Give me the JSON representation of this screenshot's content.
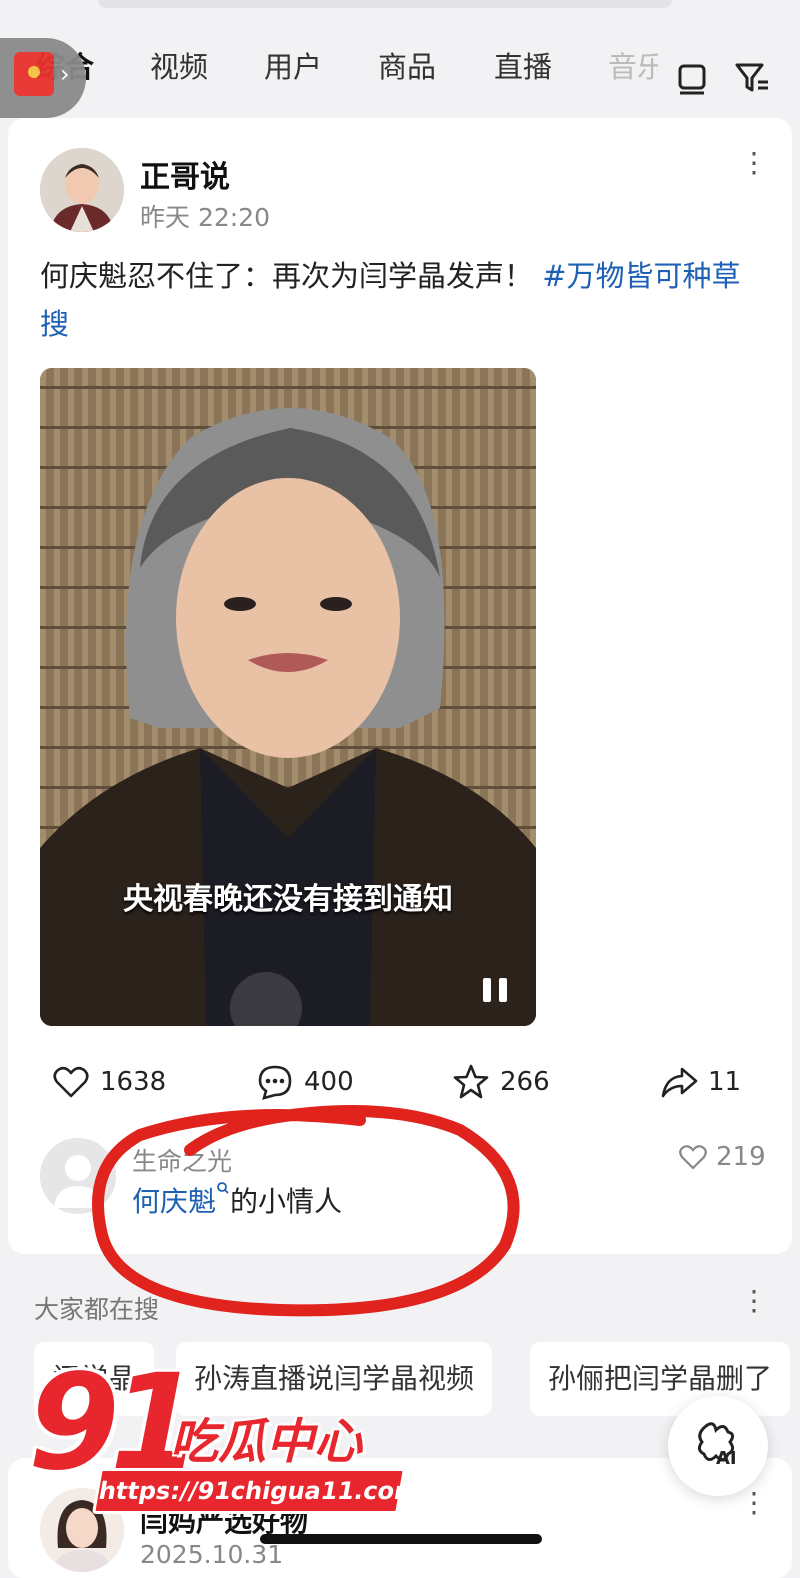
{
  "tabs": [
    {
      "label": "综合",
      "active": true
    },
    {
      "label": "视频"
    },
    {
      "label": "用户"
    },
    {
      "label": "商品"
    },
    {
      "label": "直播"
    },
    {
      "label": "音乐"
    }
  ],
  "post": {
    "author": "正哥说",
    "time": "昨天 22:20",
    "text": "何庆魁忍不住了：再次为闫学晶发声！",
    "hashtag": "#万物皆可种草搜",
    "video_caption": "央视春晚还没有接到通知",
    "actions": {
      "likes": "1638",
      "comments": "400",
      "favorites": "266",
      "shares": "11"
    }
  },
  "comment": {
    "name": "生命之光",
    "link_text": "何庆魁",
    "text": "的小情人",
    "likes": "219"
  },
  "related": {
    "title": "大家都在搜",
    "chips": [
      "闫学晶",
      "孙涛直播说闫学晶视频",
      "孙俪把闫学晶删了"
    ]
  },
  "post2": {
    "author": "闫妈严选好物",
    "time": "2025.10.31"
  },
  "ai_button": "AI",
  "watermark": {
    "number": "91",
    "name": "吃瓜中心",
    "url": "https://91chigua11.com"
  },
  "colors": {
    "accent": "#1e60b4",
    "brand_red": "#e8262d",
    "annotation_red": "#e0231c"
  }
}
